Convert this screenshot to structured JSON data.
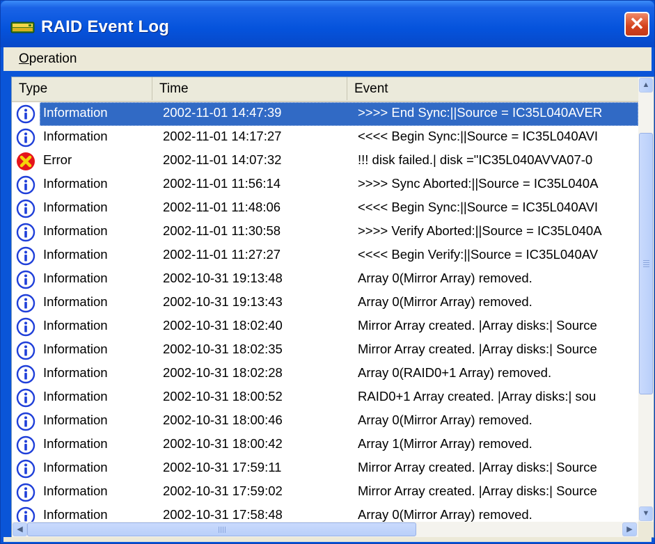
{
  "window": {
    "title": "RAID Event Log",
    "close_glyph": "✕",
    "icon": "raid-drive-icon"
  },
  "menu": {
    "items": [
      {
        "label": "Operation",
        "mnemonic": "O"
      }
    ]
  },
  "columns": {
    "type": "Type",
    "time": "Time",
    "event": "Event"
  },
  "rows": [
    {
      "icon": "information-icon",
      "type": "Information",
      "time": "2002-11-01 14:47:39",
      "event": ">>>> End Sync:||Source = IC35L040AVER",
      "selected": true
    },
    {
      "icon": "information-icon",
      "type": "Information",
      "time": "2002-11-01 14:17:27",
      "event": "<<<< Begin Sync:||Source = IC35L040AVI"
    },
    {
      "icon": "error-icon",
      "type": "Error",
      "time": "2002-11-01 14:07:32",
      "event": "!!! disk failed.| disk =\"IC35L040AVVA07-0"
    },
    {
      "icon": "information-icon",
      "type": "Information",
      "time": "2002-11-01 11:56:14",
      "event": ">>>> Sync Aborted:||Source = IC35L040A"
    },
    {
      "icon": "information-icon",
      "type": "Information",
      "time": "2002-11-01 11:48:06",
      "event": "<<<< Begin Sync:||Source = IC35L040AVI"
    },
    {
      "icon": "information-icon",
      "type": "Information",
      "time": "2002-11-01 11:30:58",
      "event": ">>>> Verify Aborted:||Source = IC35L040A"
    },
    {
      "icon": "information-icon",
      "type": "Information",
      "time": "2002-11-01 11:27:27",
      "event": "<<<< Begin Verify:||Source = IC35L040AV"
    },
    {
      "icon": "information-icon",
      "type": "Information",
      "time": "2002-10-31 19:13:48",
      "event": "Array 0(Mirror Array) removed."
    },
    {
      "icon": "information-icon",
      "type": "Information",
      "time": "2002-10-31 19:13:43",
      "event": "Array 0(Mirror Array) removed."
    },
    {
      "icon": "information-icon",
      "type": "Information",
      "time": "2002-10-31 18:02:40",
      "event": "Mirror Array created. |Array disks:| Source"
    },
    {
      "icon": "information-icon",
      "type": "Information",
      "time": "2002-10-31 18:02:35",
      "event": "Mirror Array created. |Array disks:| Source"
    },
    {
      "icon": "information-icon",
      "type": "Information",
      "time": "2002-10-31 18:02:28",
      "event": "Array 0(RAID0+1 Array) removed."
    },
    {
      "icon": "information-icon",
      "type": "Information",
      "time": "2002-10-31 18:00:52",
      "event": "RAID0+1 Array created. |Array disks:| sou"
    },
    {
      "icon": "information-icon",
      "type": "Information",
      "time": "2002-10-31 18:00:46",
      "event": "Array 0(Mirror Array) removed."
    },
    {
      "icon": "information-icon",
      "type": "Information",
      "time": "2002-10-31 18:00:42",
      "event": "Array 1(Mirror Array) removed."
    },
    {
      "icon": "information-icon",
      "type": "Information",
      "time": "2002-10-31 17:59:11",
      "event": "Mirror Array created. |Array disks:| Source"
    },
    {
      "icon": "information-icon",
      "type": "Information",
      "time": "2002-10-31 17:59:02",
      "event": "Mirror Array created. |Array disks:| Source"
    },
    {
      "icon": "information-icon",
      "type": "Information",
      "time": "2002-10-31 17:58:48",
      "event": "Array 0(Mirror Array) removed."
    }
  ],
  "colors": {
    "titlebar": "#0553dc",
    "selection": "#316ac5",
    "info_icon": "#1f3fd9",
    "error_icon": "#e5141b",
    "error_cross": "#f5d40a"
  },
  "scrollbars": {
    "up": "▲",
    "down": "▼",
    "left": "◀",
    "right": "▶"
  }
}
